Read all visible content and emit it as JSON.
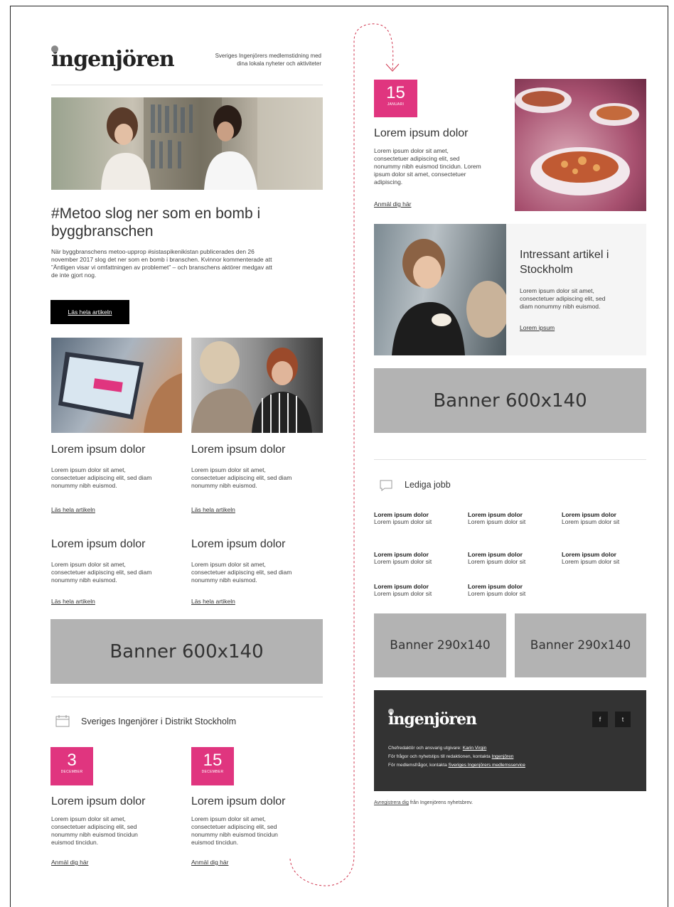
{
  "header": {
    "logo_text": "ingenjören",
    "tagline_line1": "Sveriges Ingenjörers medlemstidning med",
    "tagline_line2": "dina lokala nyheter och aktiviteter"
  },
  "hero": {
    "title_line1": "#Metoo slog ner som en bomb i",
    "title_line2": "byggbranschen",
    "body_lines": [
      "När byggbranschens metoo-upprop #sistaspikenikistan publicerades den 26",
      "november 2017 slog det ner som en bomb i branschen. Kvinnor kommenterade att",
      "”Äntligen visar vi omfattningen av problemet” – och branschens aktörer medgav att",
      "de inte gjort nog."
    ],
    "button_label": "Läs hela artikeln"
  },
  "articles": [
    {
      "title": "Lorem ipsum dolor",
      "lines": [
        "Lorem ipsum dolor sit amet,",
        "consectetuer adipiscing elit, sed diam",
        "nonummy nibh euismod."
      ],
      "link": "Läs hela artikeln"
    },
    {
      "title": "Lorem ipsum dolor",
      "lines": [
        "Lorem ipsum dolor sit amet,",
        "consectetuer adipiscing elit, sed diam",
        "nonummy nibh euismod."
      ],
      "link": "Läs hela artikeln"
    },
    {
      "title": "Lorem ipsum dolor",
      "lines": [
        "Lorem ipsum dolor sit amet,",
        "consectetuer adipiscing elit, sed diam",
        "nonummy nibh euismod."
      ],
      "link": "Läs hela artikeln"
    },
    {
      "title": "Lorem ipsum dolor",
      "lines": [
        "Lorem ipsum dolor sit amet,",
        "consectetuer adipiscing elit, sed diam",
        "nonummy nibh euismod."
      ],
      "link": "Läs hela artikeln"
    }
  ],
  "banner_large_left": "Banner 600x140",
  "events_section": {
    "heading": "Sveriges Ingenjörer i Distrikt Stockholm",
    "events": [
      {
        "day": "3",
        "month": "DECEMBER",
        "title": "Lorem ipsum dolor",
        "lines": [
          "Lorem ipsum dolor sit amet,",
          "consectetuer adipiscing elit, sed",
          "nonummy nibh euismod tincidun",
          "euismod tincidun."
        ],
        "link": "Anmäl dig här"
      },
      {
        "day": "15",
        "month": "DECEMBER",
        "title": "Lorem ipsum dolor",
        "lines": [
          "Lorem ipsum dolor sit amet,",
          "consectetuer adipiscing elit, sed",
          "nonummy nibh euismod tincidun",
          "euismod tincidun."
        ],
        "link": "Anmäl dig här"
      }
    ]
  },
  "right_event": {
    "day": "15",
    "month": "JANUARI",
    "title": "Lorem ipsum dolor",
    "lines": [
      "Lorem ipsum dolor sit amet,",
      "consectetuer adipiscing elit, sed",
      "nonummy nibh euismod tincidun. Lorem",
      "ipsum dolor sit amet, consectetuer",
      "adipiscing."
    ],
    "link": "Anmäl dig här"
  },
  "feature": {
    "title_line1": "Intressant artikel i",
    "title_line2": "Stockholm",
    "lines": [
      "Lorem ipsum dolor sit amet,",
      "consectetuer adipiscing elit, sed",
      "diam nonummy nibh euismod."
    ],
    "link": "Lorem ipsum"
  },
  "banner_large_right": "Banner 600x140",
  "jobs": {
    "heading": "Lediga jobb",
    "items": [
      {
        "title": "Lorem ipsum dolor",
        "sub": "Lorem ipsum dolor sit"
      },
      {
        "title": "Lorem ipsum dolor",
        "sub": "Lorem ipsum dolor sit"
      },
      {
        "title": "Lorem ipsum dolor",
        "sub": "Lorem ipsum dolor sit"
      },
      {
        "title": "Lorem ipsum dolor",
        "sub": "Lorem ipsum dolor sit"
      },
      {
        "title": "Lorem ipsum dolor",
        "sub": "Lorem ipsum dolor sit"
      },
      {
        "title": "Lorem ipsum dolor",
        "sub": "Lorem ipsum dolor sit"
      },
      {
        "title": "Lorem ipsum dolor",
        "sub": "Lorem ipsum dolor sit"
      },
      {
        "title": "Lorem ipsum dolor",
        "sub": "Lorem ipsum dolor sit"
      }
    ]
  },
  "banner_small_1": "Banner 290x140",
  "banner_small_2": "Banner 290x140",
  "footer": {
    "logo_text": "ingenjören",
    "line1_prefix": "Chefredaktör och ansvarig utgivare:",
    "line1_link": "Karin Virgin",
    "line2_prefix": "För frågor och nyhetstips till redaktionen, kontakta",
    "line2_link": "Ingenjören",
    "line3_prefix": "För medlemsfrågor, kontakta",
    "line3_link": "Sveriges Ingenjörers medlemsservice",
    "social_1": "f",
    "social_2": "t"
  },
  "unsubscribe": {
    "link": "Avregistrera dig",
    "suffix": "från Ingenjörens nyhetsbrev."
  },
  "colors": {
    "accent_pink": "#e0357f",
    "footer_bg": "#333333",
    "banner_gray": "#b3b3b3",
    "dashed_path": "#d0364f"
  },
  "icons": {
    "calendar": "calendar-icon",
    "chat": "chat-bubble-icon",
    "facebook": "facebook-icon",
    "twitter": "twitter-icon"
  }
}
